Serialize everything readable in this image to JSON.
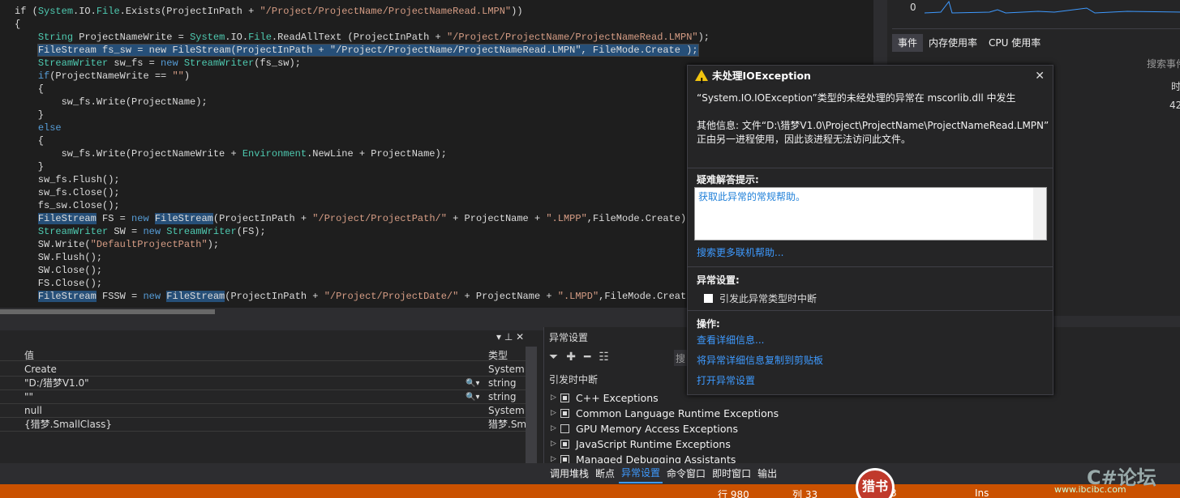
{
  "editor": {
    "lines": [
      [
        {
          "t": "if ("
        },
        {
          "t": "System",
          "c": "ty"
        },
        {
          "t": ".IO."
        },
        {
          "t": "File",
          "c": "ty"
        },
        {
          "t": ".Exists(ProjectInPath + "
        },
        {
          "t": "\"/Project/ProjectName/ProjectNameRead.LMPN\"",
          "c": "st"
        },
        {
          "t": "))"
        }
      ],
      [
        {
          "t": "{"
        }
      ],
      [
        {
          "t": "    "
        },
        {
          "t": "String",
          "c": "ty"
        },
        {
          "t": " ProjectNameWrite = "
        },
        {
          "t": "System",
          "c": "ty"
        },
        {
          "t": ".IO."
        },
        {
          "t": "File",
          "c": "ty"
        },
        {
          "t": ".ReadAllText (ProjectInPath + "
        },
        {
          "t": "\"/Project/ProjectName/ProjectNameRead.LMPN\"",
          "c": "st"
        },
        {
          "t": ");"
        }
      ],
      [
        {
          "t": "    "
        },
        {
          "t": "FileStream fs_sw = new FileStream(ProjectInPath + \"/Project/ProjectName/ProjectNameRead.LMPN\", FileMode.Create );",
          "c": "cur"
        }
      ],
      [
        {
          "t": "    "
        },
        {
          "t": "StreamWriter",
          "c": "ty"
        },
        {
          "t": " sw_fs = "
        },
        {
          "t": "new",
          "c": "kw"
        },
        {
          "t": " "
        },
        {
          "t": "StreamWriter",
          "c": "ty"
        },
        {
          "t": "(fs_sw);"
        }
      ],
      [
        {
          "t": "    "
        },
        {
          "t": "if",
          "c": "kw"
        },
        {
          "t": "(ProjectNameWrite == "
        },
        {
          "t": "\"\"",
          "c": "st"
        },
        {
          "t": ")"
        }
      ],
      [
        {
          "t": "    {"
        }
      ],
      [
        {
          "t": "        sw_fs.Write(ProjectName);"
        }
      ],
      [
        {
          "t": "    }"
        }
      ],
      [
        {
          "t": "    "
        },
        {
          "t": "else",
          "c": "kw"
        }
      ],
      [
        {
          "t": "    {"
        }
      ],
      [
        {
          "t": "        sw_fs.Write(ProjectNameWrite + "
        },
        {
          "t": "Environment",
          "c": "ty"
        },
        {
          "t": ".NewLine + ProjectName);"
        }
      ],
      [
        {
          "t": "    }"
        }
      ],
      [
        {
          "t": "    sw_fs.Flush();"
        }
      ],
      [
        {
          "t": "    sw_fs.Close();"
        }
      ],
      [
        {
          "t": "    fs_sw.Close();"
        }
      ],
      [
        {
          "t": "    "
        },
        {
          "t": "FileStream",
          "c": "hl"
        },
        {
          "t": " FS = "
        },
        {
          "t": "new",
          "c": "kw"
        },
        {
          "t": " "
        },
        {
          "t": "FileStream",
          "c": "hl"
        },
        {
          "t": "(ProjectInPath + "
        },
        {
          "t": "\"/Project/ProjectPath/\"",
          "c": "st"
        },
        {
          "t": " + ProjectName + "
        },
        {
          "t": "\".LMPP\"",
          "c": "st"
        },
        {
          "t": ",FileMode.Create);"
        }
      ],
      [
        {
          "t": "    "
        },
        {
          "t": "StreamWriter",
          "c": "ty"
        },
        {
          "t": " SW = "
        },
        {
          "t": "new",
          "c": "kw"
        },
        {
          "t": " "
        },
        {
          "t": "StreamWriter",
          "c": "ty"
        },
        {
          "t": "(FS);"
        }
      ],
      [
        {
          "t": "    SW.Write("
        },
        {
          "t": "\"DefaultProjectPath\"",
          "c": "st"
        },
        {
          "t": ");"
        }
      ],
      [
        {
          "t": "    SW.Flush();"
        }
      ],
      [
        {
          "t": "    SW.Close();"
        }
      ],
      [
        {
          "t": "    FS.Close();"
        }
      ],
      [
        {
          "t": "    "
        },
        {
          "t": "FileStream",
          "c": "hl"
        },
        {
          "t": " FSSW = "
        },
        {
          "t": "new",
          "c": "kw"
        },
        {
          "t": " "
        },
        {
          "t": "FileStream",
          "c": "hl"
        },
        {
          "t": "(ProjectInPath + "
        },
        {
          "t": "\"/Project/ProjectDate/\"",
          "c": "st"
        },
        {
          "t": " + ProjectName + "
        },
        {
          "t": "\".LMPD\"",
          "c": "st"
        },
        {
          "t": ",FileMode.Create);"
        }
      ]
    ]
  },
  "diag": {
    "zero_label": "0",
    "tabs": [
      "事件",
      "内存使用率",
      "CPU 使用率"
    ],
    "search": "搜索事件",
    "col": "时",
    "val": "42"
  },
  "locals": {
    "col_value": "值",
    "col_type": "类型",
    "rows": [
      {
        "value": "Create",
        "type": "System.I"
      },
      {
        "value": "\"D:/猎梦V1.0\"",
        "type": "string"
      },
      {
        "value": "\"\"",
        "type": "string"
      },
      {
        "value": "null",
        "type": "System.I"
      },
      {
        "value": "{猎梦.SmallClass}",
        "type": "猎梦.Sm"
      }
    ]
  },
  "exception_settings": {
    "title": "异常设置",
    "search": "搜",
    "group": "引发时中断",
    "items": [
      {
        "label": "C++ Exceptions",
        "checked": true
      },
      {
        "label": "Common Language Runtime Exceptions",
        "checked": true
      },
      {
        "label": "GPU Memory Access Exceptions",
        "checked": false
      },
      {
        "label": "JavaScript Runtime Exceptions",
        "checked": true
      },
      {
        "label": "Managed Debugging Assistants",
        "checked": true
      }
    ]
  },
  "bottom_tabs": [
    "调用堆栈",
    "断点",
    "异常设置",
    "命令窗口",
    "即时窗口",
    "输出"
  ],
  "status": {
    "line": "行 980",
    "col": "列 33",
    "ch": "3",
    "ins": "Ins"
  },
  "popup": {
    "title": "未处理IOException",
    "message": "“System.IO.IOException”类型的未经处理的异常在 mscorlib.dll 中发生",
    "more_info_1": "其他信息: 文件“D:\\猎梦V1.0\\Project\\ProjectName\\ProjectNameRead.LMPN”",
    "more_info_2": "正由另一进程使用，因此该进程无法访问此文件。",
    "tips_header": "疑难解答提示:",
    "tip_link": "获取此异常的常规帮助。",
    "search_online": "搜索更多联机帮助...",
    "exc_settings_header": "异常设置:",
    "break_checkbox": "引发此异常类型时中断",
    "actions_header": "操作:",
    "action_details": "查看详细信息...",
    "action_copy": "将异常详细信息复制到剪贴板",
    "action_open": "打开异常设置"
  },
  "watermark": {
    "logo": "猎书",
    "brand": "C#论坛",
    "url": "www.ibcibc.com"
  }
}
